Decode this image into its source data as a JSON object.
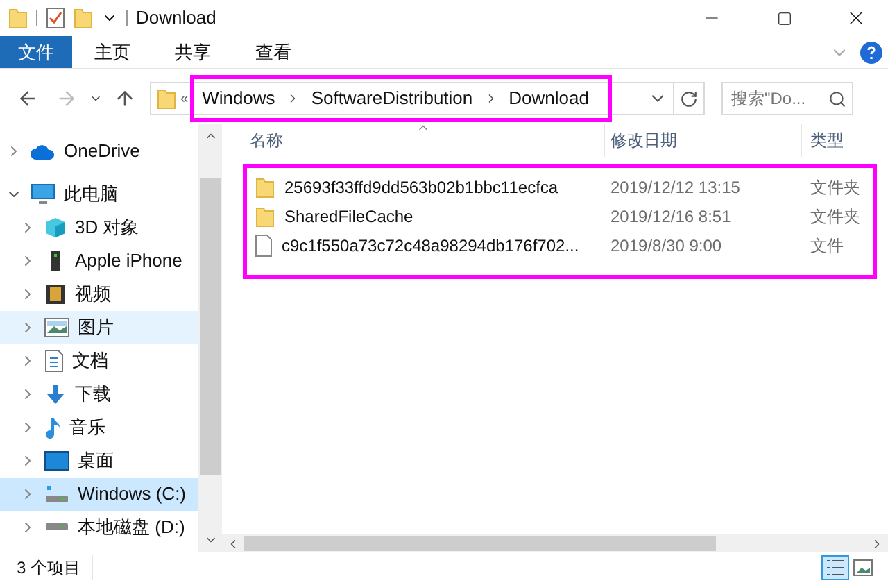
{
  "window": {
    "title": "Download"
  },
  "ribbon_tabs": [
    {
      "label": "文件",
      "kind": "file",
      "selected": false
    },
    {
      "label": "主页",
      "kind": "tab",
      "selected": false
    },
    {
      "label": "共享",
      "kind": "tab",
      "selected": false
    },
    {
      "label": "查看",
      "kind": "tab",
      "selected": false
    }
  ],
  "address_bar": {
    "overflow": "«",
    "breadcrumbs": [
      "Windows",
      "SoftwareDistribution",
      "Download"
    ],
    "highlighted": true
  },
  "search": {
    "placeholder": "搜索\"Do..."
  },
  "sidebar": {
    "items": [
      {
        "label": "OneDrive",
        "kind": "cloud",
        "expanded": false,
        "selected": false,
        "hovered": false
      },
      {
        "label": "此电脑",
        "kind": "computer",
        "expanded": true,
        "selected": false,
        "hovered": false,
        "children": [
          {
            "label": "3D 对象",
            "kind": "cube",
            "expanded": false,
            "selected": false,
            "hovered": false
          },
          {
            "label": "Apple iPhone",
            "kind": "phone",
            "expanded": false,
            "selected": false,
            "hovered": false
          },
          {
            "label": "视频",
            "kind": "video",
            "expanded": false,
            "selected": false,
            "hovered": false
          },
          {
            "label": "图片",
            "kind": "pictures",
            "expanded": false,
            "selected": false,
            "hovered": true
          },
          {
            "label": "文档",
            "kind": "documents",
            "expanded": false,
            "selected": false,
            "hovered": false
          },
          {
            "label": "下载",
            "kind": "downloads",
            "expanded": false,
            "selected": false,
            "hovered": false
          },
          {
            "label": "音乐",
            "kind": "music",
            "expanded": false,
            "selected": false,
            "hovered": false
          },
          {
            "label": "桌面",
            "kind": "desktop",
            "expanded": false,
            "selected": false,
            "hovered": false
          },
          {
            "label": "Windows (C:)",
            "kind": "system_drive",
            "expanded": false,
            "selected": true,
            "hovered": false
          },
          {
            "label": "本地磁盘 (D:)",
            "kind": "drive",
            "expanded": false,
            "selected": false,
            "hovered": false
          }
        ]
      }
    ]
  },
  "file_list": {
    "columns": [
      "名称",
      "修改日期",
      "类型"
    ],
    "highlighted": true,
    "rows": [
      {
        "name": "25693f33ffd9dd563b02b1bbc11ecfca",
        "modified": "2019/12/12 13:15",
        "type": "文件夹",
        "kind": "folder"
      },
      {
        "name": "SharedFileCache",
        "modified": "2019/12/16 8:51",
        "type": "文件夹",
        "kind": "folder"
      },
      {
        "name": "c9c1f550a73c72c48a98294db176f702...",
        "modified": "2019/8/30 9:00",
        "type": "文件",
        "kind": "file"
      }
    ]
  },
  "status_bar": {
    "item_count": "3 个项目",
    "views": [
      {
        "kind": "details",
        "selected": true
      },
      {
        "kind": "thumbnails",
        "selected": false
      }
    ]
  }
}
